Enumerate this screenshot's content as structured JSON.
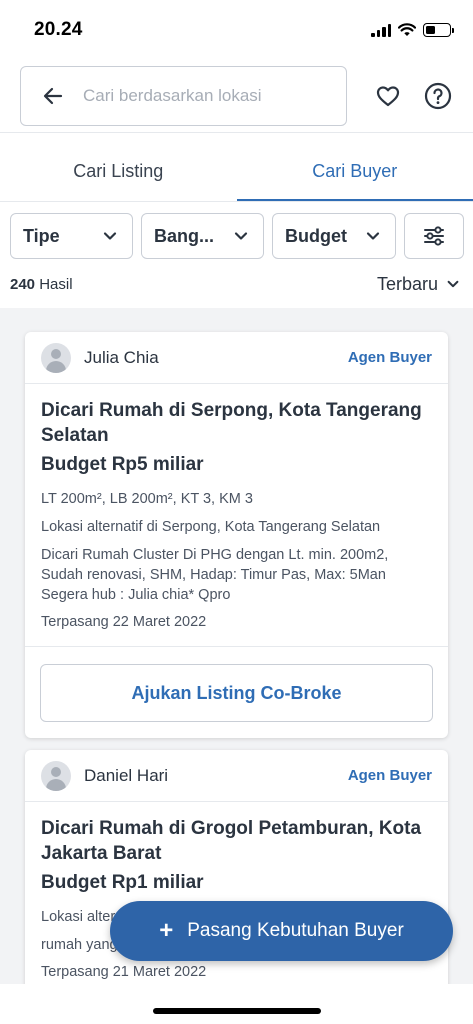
{
  "status_bar": {
    "time": "20.24"
  },
  "search": {
    "placeholder": "Cari berdasarkan lokasi"
  },
  "tabs": [
    {
      "label": "Cari Listing",
      "active": false
    },
    {
      "label": "Cari Buyer",
      "active": true
    }
  ],
  "filters": [
    {
      "label": "Tipe"
    },
    {
      "label": "Bang..."
    },
    {
      "label": "Budget"
    }
  ],
  "results": {
    "count": "240",
    "suffix": "Hasil",
    "sort_label": "Terbaru"
  },
  "cards": [
    {
      "agent_name": "Julia Chia",
      "agent_role": "Agen Buyer",
      "title": "Dicari Rumah di Serpong, Kota Tangerang Selatan",
      "budget": "Budget Rp5 miliar",
      "specs": "LT 200m², LB 200m², KT 3, KM 3",
      "alt_location": "Lokasi alternatif di Serpong, Kota Tangerang Selatan",
      "description": "Dicari Rumah Cluster Di PHG dengan Lt. min. 200m2, Sudah renovasi, SHM, Hadap: Timur Pas, Max: 5Man Segera hub : Julia chia* Qpro",
      "posted": "Terpasang 22 Maret 2022",
      "action_label": "Ajukan Listing Co-Broke"
    },
    {
      "agent_name": "Daniel Hari",
      "agent_role": "Agen Buyer",
      "title": "Dicari Rumah di Grogol Petamburan, Kota Jakarta Barat",
      "budget": "Budget Rp1 miliar",
      "alt_location": "Lokasi alternatif di Grogol Petamburan, Kota Jakarta Barat",
      "description": "rumah yang sesuai dengan budget saya",
      "posted": "Terpasang 21 Maret 2022"
    }
  ],
  "fab": {
    "label": "Pasang Kebutuhan Buyer"
  },
  "colors": {
    "accent": "#2f6db5",
    "fab": "#2e64a8",
    "list_bg": "#f2f3f5",
    "border": "#c9ced6"
  }
}
